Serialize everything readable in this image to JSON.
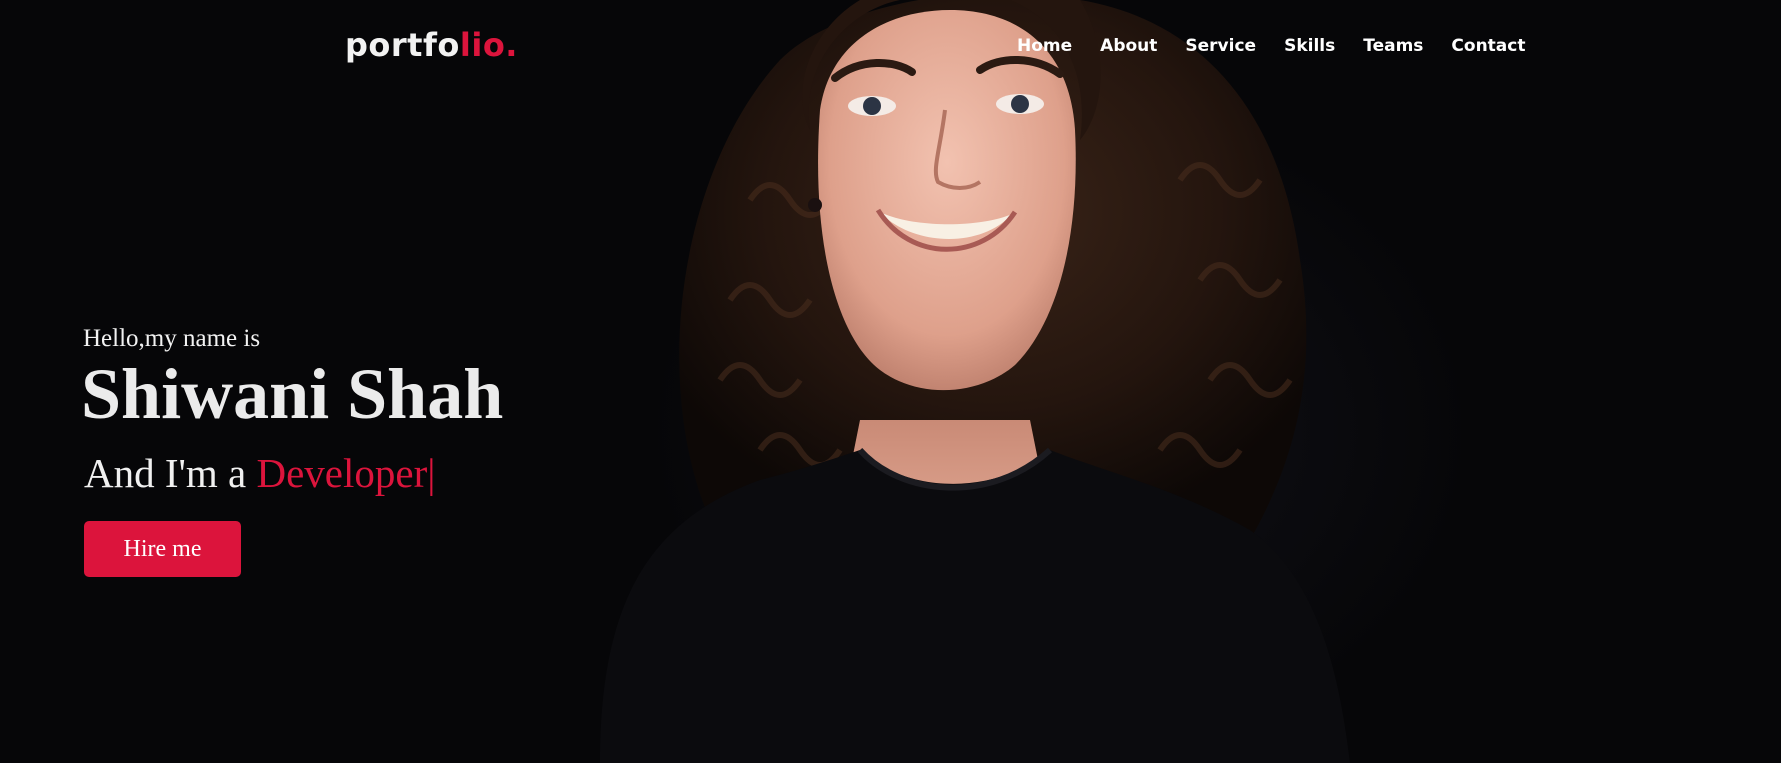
{
  "brand": {
    "logo_main": "portfo",
    "logo_accent": "lio."
  },
  "nav": {
    "items": [
      {
        "label": "Home"
      },
      {
        "label": "About"
      },
      {
        "label": "Service"
      },
      {
        "label": "Skills"
      },
      {
        "label": "Teams"
      },
      {
        "label": "Contact"
      }
    ]
  },
  "hero": {
    "greeting": "Hello,my name is",
    "name": "Shiwani Shah",
    "role_prefix": "And I'm a ",
    "role_typed": "Developer",
    "cursor": "|",
    "cta_label": "Hire me"
  },
  "colors": {
    "accent": "#dc143c",
    "background": "#060608",
    "text": "#f2f2f2"
  }
}
